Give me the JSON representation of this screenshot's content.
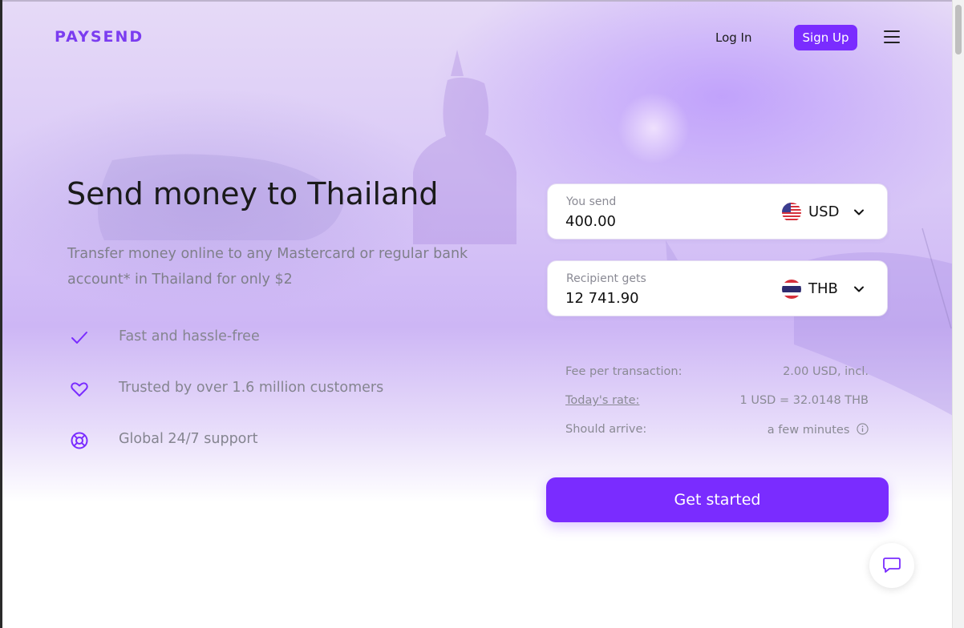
{
  "header": {
    "logo": "PAYSEND",
    "login_label": "Log In",
    "signup_label": "Sign Up"
  },
  "hero": {
    "title": "Send money to Thailand",
    "subtitle": "Transfer money online to any Mastercard or regular bank account* in Thailand for only $2",
    "features": [
      {
        "icon": "check-icon",
        "label": "Fast and hassle-free"
      },
      {
        "icon": "heart-icon",
        "label": "Trusted by over 1.6 million customers"
      },
      {
        "icon": "lifebuoy-icon",
        "label": "Global 24/7 support"
      }
    ]
  },
  "calculator": {
    "send": {
      "label": "You send",
      "value": "400.00",
      "currency": "USD",
      "flag": "us-flag-icon"
    },
    "receive": {
      "label": "Recipient gets",
      "value": "12 741.90",
      "currency": "THB",
      "flag": "th-flag-icon"
    },
    "fee_label": "Fee per transaction:",
    "fee_value": "2.00 USD, incl.",
    "rate_label": "Today's rate:",
    "rate_value": "1 USD = 32.0148 THB",
    "arrive_label": "Should arrive:",
    "arrive_value": "a few minutes",
    "cta_label": "Get started"
  },
  "colors": {
    "accent": "#7a2cff",
    "logo": "#7b3cf0",
    "muted_text": "#858590"
  }
}
